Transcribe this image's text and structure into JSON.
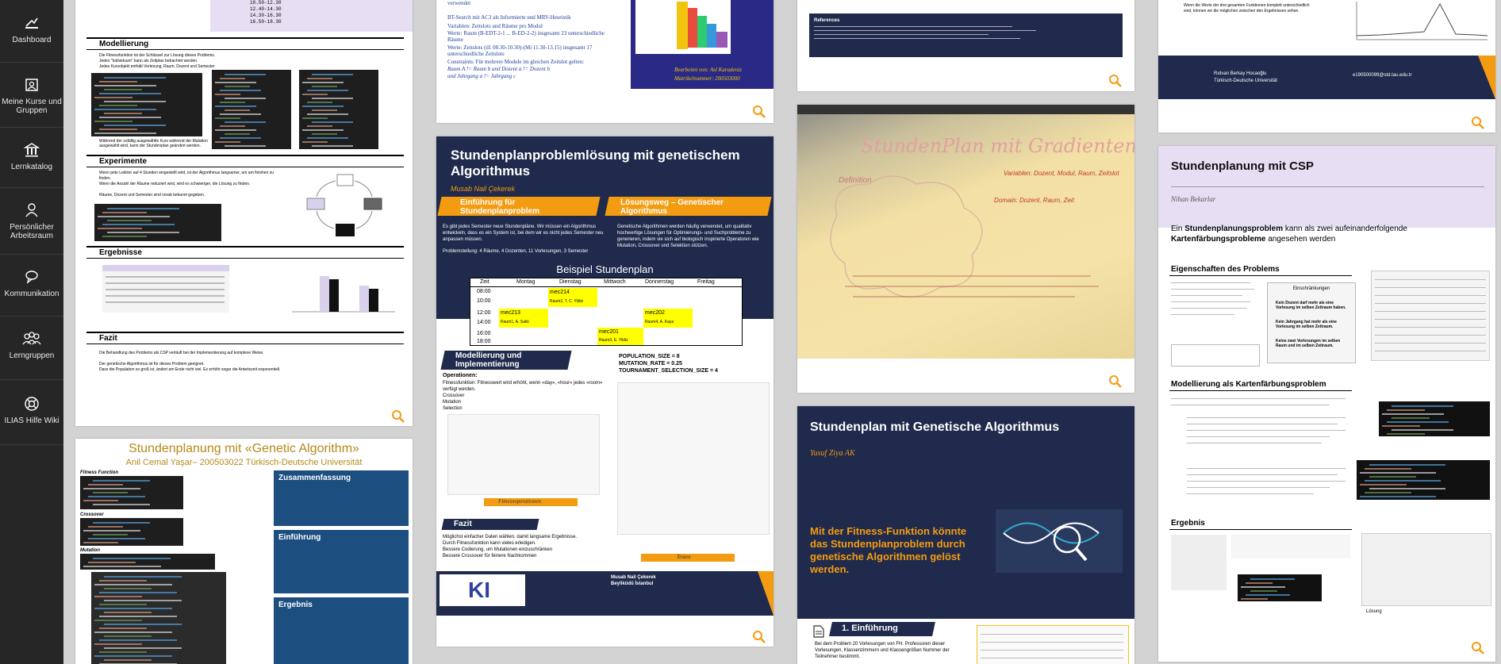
{
  "sidebar": {
    "items": [
      {
        "label": "Dashboard",
        "icon": "dashboard-icon"
      },
      {
        "label": "Meine Kurse und Gruppen",
        "icon": "courses-icon"
      },
      {
        "label": "Lernkatalog",
        "icon": "catalog-icon"
      },
      {
        "label": "Persönlicher Arbeitsraum",
        "icon": "workspace-icon"
      },
      {
        "label": "Kommunikation",
        "icon": "communication-icon"
      },
      {
        "label": "Lerngruppen",
        "icon": "groups-icon"
      },
      {
        "label": "ILIAS Hilfe Wiki",
        "icon": "help-icon"
      }
    ]
  },
  "cards": {
    "c1": {
      "table_rows": [
        "10.50-12.30",
        "12.40-14.30",
        "14.30-16.30",
        "16.50-18.30"
      ],
      "s1_title": "Modellierung",
      "s1_bullets": [
        "Die Fitnessfunktion ist der Schlüssel zur Lösung dieses Problems.",
        "Jedes \"Individuum\" kann als Zeitplan betrachtet werden.",
        "Jedes Kursobjekt enthält Vorlesung, Raum, Dozent und Semester"
      ],
      "s1_note": "Während der zufällig ausgewählte Kurs während der Mutation ausgewählt wird, kann der Stundenplan geändert werden.",
      "s2_title": "Experimente",
      "s2_bullets": [
        "Wenn jede Lektion auf 4 Stunden eingestellt wird, ist der Algorithmus langsamer, um am finishen zu finden.",
        "Wenn die Anzahl der Räume reduziert wird, wird es schwieriger, die Lösung zu finden.",
        "Räume, Dozent und Semester sind vorab bekannt gegeben."
      ],
      "s3_title": "Ergebnisse",
      "s4_title": "Fazit",
      "s4_bullets": [
        "Die Behandlung des Problems als CSP verläuft bei der Implementierung auf komplexe Weise.",
        "Der genetische Algorithmus ist für dieses Problem geeignet.",
        "Dass die Population so groß ist, ändert am Ende nicht viel. Es erhöht sogar die Arbeitszeit exponentiell."
      ]
    },
    "c2": {
      "title": "Stundenplanung mit «Genetic Algorithm»",
      "author": "Anil Cemal Yaşar– 200503022 Türkisch-Deutsche Universität",
      "labels": [
        "Fitness Function",
        "Crossover",
        "Mutation"
      ],
      "boxes": [
        "Zusammenfassung",
        "Einführung",
        "Ergebnis"
      ]
    },
    "c3": {
      "lines": [
        "verwendet",
        "BT-Search mit AC3 als Informierte und MRV-Heuristik",
        "Variablen: Zeitslots und Räume pro Modul",
        "Werte: Raum (B-EDT-2-1 ... B-ED-2-2) insgesamt 23 unterschiedliche Räume",
        "Werte: Zeitslots (d1 08.30-10.30)-(Mi 11.30-13.15) insgesamt 17 unterschiedliche Zeitslots",
        "Constraints: Für mehrere Module im gleichen Zeitslot gelten:",
        "Raum A != Raum b und Dozent a != Dozent b",
        "und Jahrgang a != Jahrgang c"
      ],
      "footer1": "Bearbeitet von: Asl Karadeniz",
      "footer2": "Matrikelnummer: 200503000"
    },
    "c4": {
      "title": "Stundenplanproblemlösung mit genetischem Algorithmus",
      "author": "Musab Nail Çekerek",
      "ribbon1": "Einführung für Stundenplanproblem",
      "ribbon2": "Lösungsweg – Genetischer Algorithmus",
      "intro": "Es gibt jedes Semester neue Stundenpläne. Wir müssen ein Algorithmus entwickeln, dass es ein System ist, bei dem wir es nicht jedes Semester neu anpassen müssen.",
      "problem": "Problemstellung: 4 Räume, 4 Dozenten, 11 Vorlesungen, 3 Semester",
      "solution": "Genetische Algorithmen werden häufig verwendet, um qualitativ hochwertige Lösungen für Optimierungs- und Suchprobleme zu generieren, indem sie sich auf biologisch inspirierte Operatoren wie Mutation, Crossover und Selektion stützen.",
      "schedule_title": "Beispiel Stundenplan",
      "days": [
        "Zeit",
        "Montag",
        "Dienstag",
        "Mittwoch",
        "Donnerstag",
        "Freitag"
      ],
      "times": [
        "08:00",
        "10:00",
        "12:00",
        "14:00",
        "16:00",
        "18:00"
      ],
      "entries": [
        {
          "code": "mec214",
          "room": "Raum2, T. C. Yildiz"
        },
        {
          "code": "mec213",
          "room": "Raum1, A. Sakli"
        },
        {
          "code": "mec202",
          "room": "Raum4, A. Kaya"
        },
        {
          "code": "mec201",
          "room": "Raum3, E. Yildiz"
        }
      ],
      "ribbon3": "Modellierung und Implementierung",
      "ops_title": "Operationen:",
      "ops": [
        "Fitnessfunktion: Fitnesswert wird erhöht, wenn «day», «hour» jedes «room» verfügt werden.",
        "Crossover",
        "Mutation",
        "Selection"
      ],
      "params": [
        "POPULATION_SIZE = 8",
        "MUTATION_RATE = 0.25",
        "TOURNAMENT_SELECTION_SIZE = 4"
      ],
      "code_label": "Fitnessoperationen",
      "test_label": "Testen",
      "ribbon4": "Fazit",
      "fazit": [
        "Möglichst einfacher Daten wählen, damit langsame Ergebnisse.",
        "Durch Fitnessfunktion kann vieles erledigen.",
        "Bessere Codierung, um Mutationen einzuschränken",
        "Bessere Crossover für feinere Nachkommen"
      ],
      "logo": "KI",
      "contact": [
        "Musab Nail Çekerek",
        "Beyliküdü İstanbul"
      ]
    },
    "c5": {
      "title": "References"
    },
    "c6": {
      "title": "StundenPlan mit Gradientensuche",
      "notes": [
        "Variablen: Dozent, Modul, Raum, Zeitslot",
        "Domain: Dozent, Raum, Zeit",
        "Definition"
      ]
    },
    "c7": {
      "title": "Stundenplan mit Genetische Algorithmus",
      "author": "Yusuf Ziya AK",
      "claim": "Mit der Fitness-Funktion könnte das Stundenplanproblem durch genetische Algorithmen gelöst werden.",
      "s1_title": "1. Einführung",
      "s1_text": "Bei dem Problem 20 Vorlesungen von FH. Professoren dieser Vorlesungen, Klassenzimmern und Klassengrößen Nummer der Teilnehmer bestimmt."
    },
    "c8": {
      "bullet": "Wenn die Werte der drei gesamten Funktionen komplett unterschiedlich sind, können wir die möglichen zwischen den Ergebnissen sehen.",
      "footer_name": "Rıdvan Berkay Hocaoğlu",
      "footer_uni": "Türkisch-Deutsche Universität",
      "footer_mail": "e190500099@std.tau.edu.tr"
    },
    "c9": {
      "title": "Stundenplanung mit CSP",
      "author": "Nihan Bekarlar",
      "intro_pre": "Ein ",
      "intro_bold": "Stundenplanungsproblem",
      "intro_mid": " kann als zwei aufeinanderfolgende ",
      "intro_bold2": "Kartenfärbungsprobleme",
      "intro_post": " angesehen werden",
      "s1_title": "Eigenschaften des Problems",
      "s1_box_title": "Einschränkungen",
      "s1_box": [
        "Kein Dozent darf mehr als eine Vorlesung im selben Zeitraum haben.",
        "Kein Jahrgang hat mehr als eine Vorlesung im selben Zeitraum.",
        "Keine zwei Vorlesungen im selben Raum und im selben Zeitraum."
      ],
      "s2_title": "Modellierung als Kartenfärbungsproblem",
      "s3_title": "Ergebnis",
      "lsg": "Lösung"
    }
  }
}
